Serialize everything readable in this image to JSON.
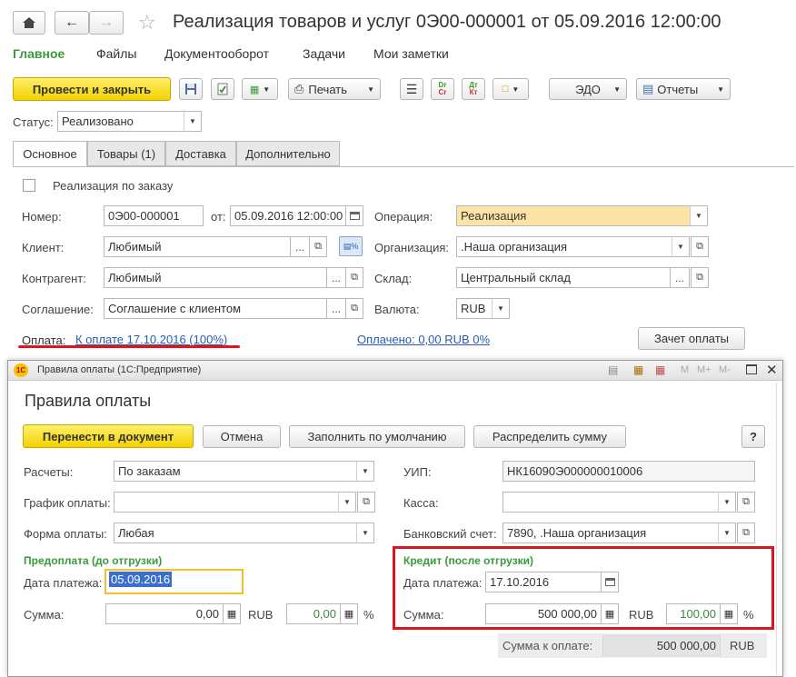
{
  "header": {
    "title": "Реализация товаров и услуг 0Э00-000001 от 05.09.2016 12:00:00"
  },
  "nav": [
    "Главное",
    "Файлы",
    "Документооборот",
    "Задачи",
    "Мои заметки"
  ],
  "toolbar": {
    "post_close": "Провести и закрыть",
    "print": "Печать",
    "edo": "ЭДО",
    "reports": "Отчеты"
  },
  "status": {
    "label": "Статус:",
    "value": "Реализовано"
  },
  "tabs": [
    "Основное",
    "Товары (1)",
    "Доставка",
    "Дополнительно"
  ],
  "form": {
    "by_order": "Реализация по заказу",
    "number_label": "Номер:",
    "number_value": "0Э00-000001",
    "from_label": "от:",
    "date_value": "05.09.2016 12:00:00",
    "operation_label": "Операция:",
    "operation_value": "Реализация",
    "client_label": "Клиент:",
    "client_value": "Любимый",
    "org_label": "Организация:",
    "org_value": ".Наша организация",
    "contractor_label": "Контрагент:",
    "contractor_value": "Любимый",
    "warehouse_label": "Склад:",
    "warehouse_value": "Центральный склад",
    "agreement_label": "Соглашение:",
    "agreement_value": "Соглашение с клиентом",
    "currency_label": "Валюта:",
    "currency_value": "RUB",
    "payment_label": "Оплата:",
    "payment_link": "К оплате 17.10.2016 (100%)",
    "paid_link": "Оплачено: 0,00 RUB  0%",
    "offset_button": "Зачет оплаты"
  },
  "dialog": {
    "window_title": "Правила оплаты  (1С:Предприятие)",
    "heading": "Правила оплаты",
    "transfer_button": "Перенести в документ",
    "cancel_button": "Отмена",
    "fill_default_button": "Заполнить по умолчанию",
    "distribute_button": "Распределить сумму",
    "help": "?",
    "settlements_label": "Расчеты:",
    "settlements_value": "По заказам",
    "schedule_label": "График оплаты:",
    "schedule_value": "",
    "form_label": "Форма оплаты:",
    "form_value": "Любая",
    "uip_label": "УИП:",
    "uip_value": "НК16090Э000000010006",
    "cash_label": "Касса:",
    "cash_value": "",
    "bank_label": "Банковский счет:",
    "bank_value": "7890, .Наша организация",
    "prepay_title": "Предоплата (до отгрузки)",
    "prepay_date_label": "Дата платежа:",
    "prepay_date_value": "05.09.2016",
    "prepay_sum_label": "Сумма:",
    "prepay_sum_value": "0,00",
    "prepay_currency": "RUB",
    "prepay_pct_value": "0,00",
    "pct_sign": "%",
    "credit_title": "Кредит (после отгрузки)",
    "credit_date_label": "Дата платежа:",
    "credit_date_value": "17.10.2016",
    "credit_sum_label": "Сумма:",
    "credit_sum_value": "500 000,00",
    "credit_currency": "RUB",
    "credit_pct_value": "100,00",
    "total_label": "Сумма к оплате:",
    "total_value": "500 000,00",
    "total_currency": "RUB",
    "win_m": "M",
    "win_mplus": "M+",
    "win_mminus": "M-"
  }
}
